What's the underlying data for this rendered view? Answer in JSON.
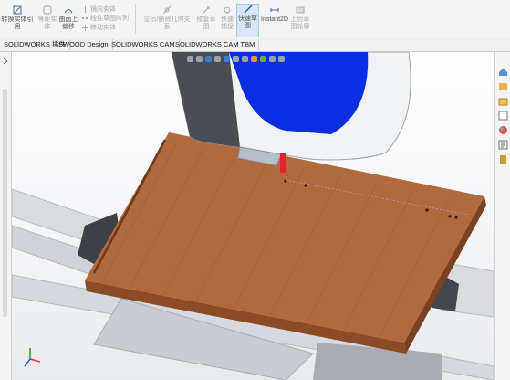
{
  "ribbon": {
    "items": [
      {
        "label": "转换实体引用",
        "enabled": true
      },
      {
        "label": "等距实体",
        "enabled": false
      },
      {
        "label": "曲面上偏移",
        "enabled": true
      },
      {
        "label": "镜向实体",
        "enabled": false
      },
      {
        "label": "线性草图阵列",
        "enabled": false
      },
      {
        "label": "移动实体",
        "enabled": false
      },
      {
        "label": "显示/删除几何关系",
        "enabled": false
      },
      {
        "label": "修复草图",
        "enabled": false
      },
      {
        "label": "快速捕捉",
        "enabled": false
      },
      {
        "label": "快速草图",
        "enabled": true,
        "active": true
      },
      {
        "label": "Instant2D",
        "enabled": true
      },
      {
        "label": "上色草图轮廓",
        "enabled": false
      }
    ]
  },
  "tabs": [
    "SOLIDWORKS 插件",
    "SWOOD Design",
    "SOLIDWORKS CAM",
    "SOLIDWORKS CAM TBM"
  ],
  "colors": {
    "wood": "#b06a3e",
    "wood_dark": "#7a4122",
    "rail": "#d4d7db",
    "head_blue": "#0b2fe0",
    "tool_red": "#e3262b"
  },
  "icons": {
    "triad": "axis-triad-icon",
    "heads_up": "view-toolbar-icons"
  }
}
